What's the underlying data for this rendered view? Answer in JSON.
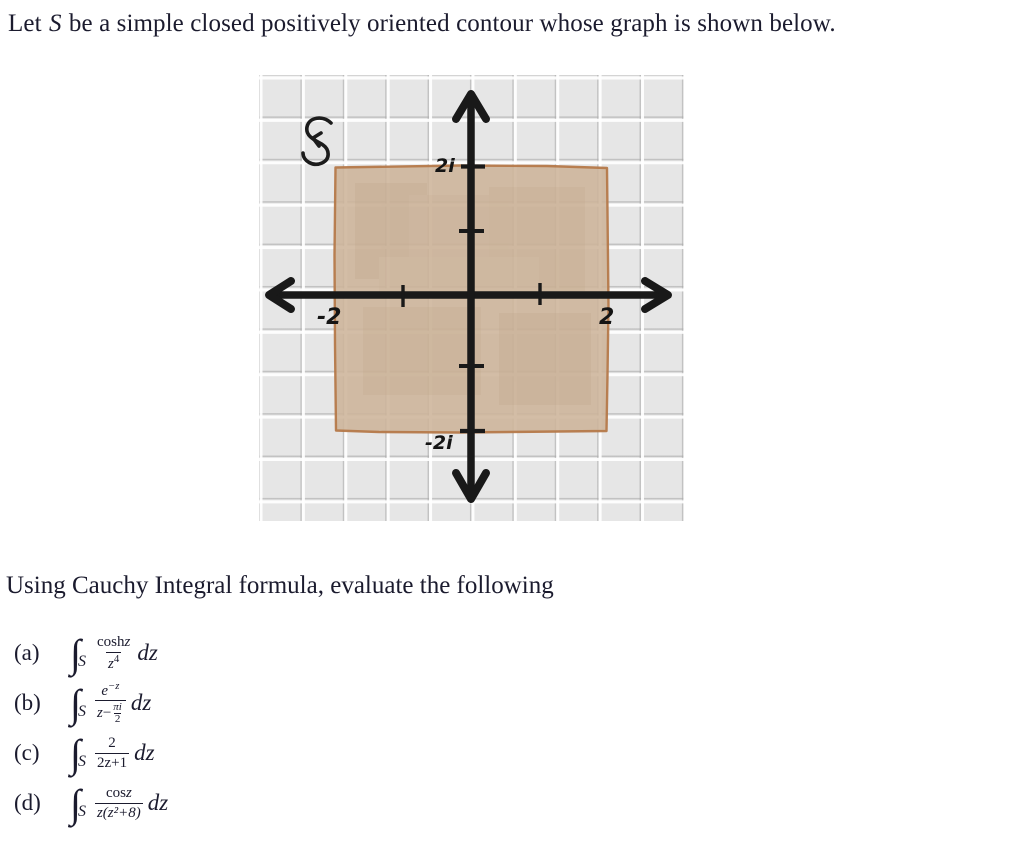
{
  "prompt": {
    "before_var": "Let ",
    "variable": "S",
    "after_var": " be a simple closed positively oriented contour whose graph is shown below."
  },
  "figure": {
    "contour_label": "S",
    "contour_label_desc": "hand-drawn script S with counterclockwise orientation arrow",
    "axis_labels": {
      "real_negative": "-2",
      "real_positive": "2",
      "imag_positive": "2i",
      "imag_negative": "-2i"
    },
    "colors": {
      "grid_cell": "#e6e6e6",
      "grid_line": "#a5a5a5",
      "contour_fill": "#cdb49a",
      "contour_stroke": "#b5794a",
      "axis": "#1a1a1a"
    },
    "region": {
      "shape": "square",
      "real_range": [
        -2,
        2
      ],
      "imag_range": [
        -2,
        2
      ]
    }
  },
  "subprompt": "Using Cauchy Integral formula, evaluate the following",
  "items": [
    {
      "label": "(a)",
      "integral": "∫",
      "subscript": "S",
      "numerator_function": "cosh",
      "numerator_var": "z",
      "denominator_var": "z",
      "denominator_power": "4",
      "differential": "dz",
      "plain": "∫_S (cosh z)/z^4 dz"
    },
    {
      "label": "(b)",
      "integral": "∫",
      "subscript": "S",
      "numerator_base": "e",
      "numerator_exponent": "−z",
      "denominator_var": "z",
      "denominator_minus": "−",
      "denominator_frac_num": "πi",
      "denominator_frac_den": "2",
      "differential": "dz",
      "plain": "∫_S e^(−z)/(z − πi/2) dz"
    },
    {
      "label": "(c)",
      "integral": "∫",
      "subscript": "S",
      "numerator": "2",
      "denominator": "2z+1",
      "differential": "dz",
      "plain": "∫_S 2/(2z+1) dz"
    },
    {
      "label": "(d)",
      "integral": "∫",
      "subscript": "S",
      "numerator_function": "cos",
      "numerator_var": "z",
      "denominator": "z(z²+8)",
      "differential": "dz",
      "plain": "∫_S cos z/(z(z^2+8)) dz"
    }
  ]
}
